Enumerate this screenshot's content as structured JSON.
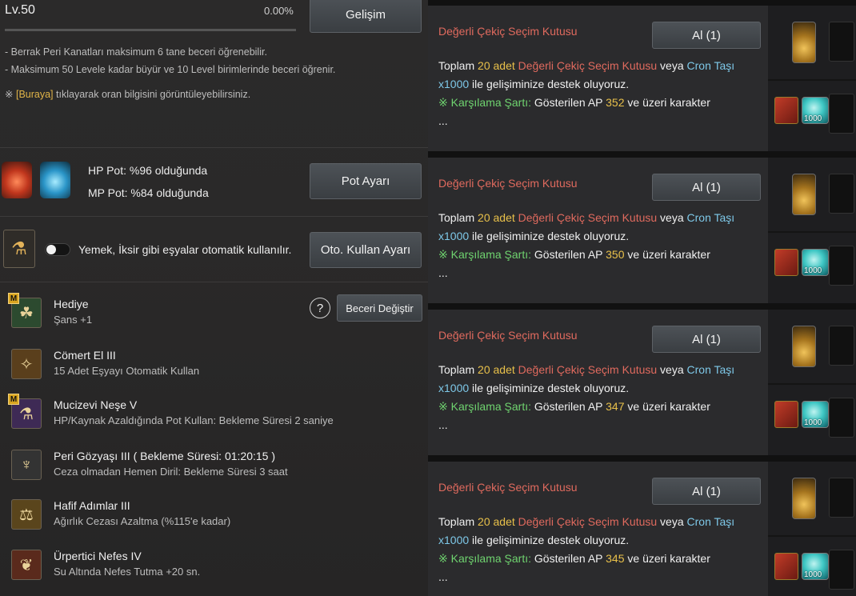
{
  "left": {
    "level": "Lv.50",
    "percent": "0.00%",
    "progress_fraction": 0.0,
    "develop_button": "Gelişim",
    "info_lines": [
      "- Berrak Peri Kanatları maksimum 6 tane beceri öğrenebilir.",
      "- Maksimum 50 Levele kadar büyür ve 10 Level birimlerinde beceri öğrenir."
    ],
    "info_prefix": "※",
    "info_link": "[Buraya]",
    "info_suffix": "tıklayarak oran bilgisini görüntüleyebilirsiniz.",
    "hp_pot": "HP Pot: %96 olduğunda",
    "mp_pot": "MP Pot: %84 olduğunda",
    "pot_button": "Pot Ayarı",
    "auto_use_text": "Yemek, İksir gibi eşyalar otomatik kullanılır.",
    "auto_use_button": "Oto. Kullan Ayarı",
    "help_symbol": "?",
    "change_skill_button": "Beceri Değiştir",
    "skill_badge": "M",
    "skills": [
      {
        "name": "Hediye",
        "desc": "Şans +1",
        "badge": true,
        "icon": "clover-icon"
      },
      {
        "name": "Cömert El III",
        "desc": "15 Adet Eşyayı Otomatik Kullan",
        "badge": false,
        "icon": "fairy-icon"
      },
      {
        "name": "Mucizevi Neşe V",
        "desc": "HP/Kaynak Azaldığında Pot Kullan: Bekleme Süresi 2 saniye",
        "badge": true,
        "icon": "potion-icon"
      },
      {
        "name": "Peri Gözyaşı III  ( Bekleme Süresi: 01:20:15 )",
        "desc": "Ceza olmadan Hemen Diril: Bekleme Süresi 3 saat",
        "badge": false,
        "icon": "tear-icon"
      },
      {
        "name": "Hafif Adımlar III",
        "desc": "Ağırlık Cezası Azaltma (%115'e kadar)",
        "badge": false,
        "icon": "weight-icon"
      },
      {
        "name": "Ürpertici Nefes IV",
        "desc": "Su Altında Nefes Tutma +20 sn.",
        "badge": false,
        "icon": "breath-icon"
      }
    ]
  },
  "right": {
    "cards": [
      {
        "title": "Değerli Çekiç Seçim Kutusu",
        "button": "Al (1)",
        "ap": "352"
      },
      {
        "title": "Değerli Çekiç Seçim Kutusu",
        "button": "Al (1)",
        "ap": "350"
      },
      {
        "title": "Değerli Çekiç Seçim Kutusu",
        "button": "Al (1)",
        "ap": "347"
      },
      {
        "title": "Değerli Çekiç Seçim Kutusu",
        "button": "Al (1)",
        "ap": "345"
      }
    ],
    "body_parts": {
      "toplam": "Toplam",
      "count": "20",
      "adet": "adet",
      "item": "Değerli Çekiç Seçim Kutusu",
      "veya": "veya",
      "cron": "Cron Taşı",
      "x1000": "x1000",
      "rest": "ile gelişiminize destek oluyoruz.",
      "cond_label": "※ Karşılama Şartı:",
      "cond_text": "Gösterilen AP",
      "cond_tail": "ve üzeri karakter",
      "ellipsis": "..."
    },
    "gem_qty": "1000"
  }
}
